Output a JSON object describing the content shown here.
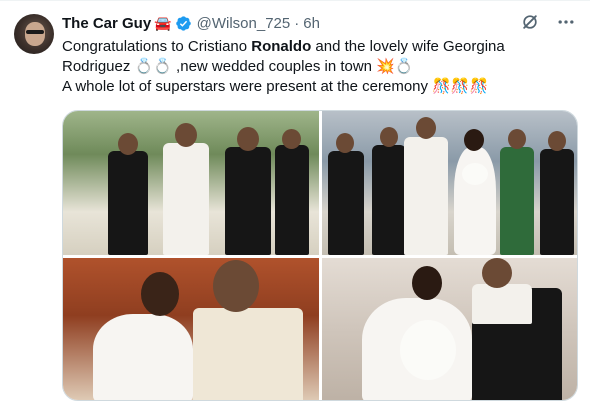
{
  "tweet": {
    "display_name": "The Car Guy",
    "name_emoji": "🚘",
    "handle": "@Wilson_725",
    "separator": "·",
    "timestamp": "6h",
    "text": {
      "line1_pre": "Congratulations to Cristiano ",
      "line1_bold": "Ronaldo",
      "line1_post": " and the lovely wife Georgina",
      "line2": "Rodriguez 💍💍 ,new wedded couples in town 💥💍",
      "line3": "A whole lot of superstars were present at the ceremony 🎊🎊🎊"
    }
  },
  "icons": {
    "verified": "verified-badge-icon",
    "grok": "grok-icon",
    "more": "more-options-icon"
  },
  "colors": {
    "verified_blue": "#1d9bf0",
    "secondary_text": "#536471",
    "primary_text": "#0f1419",
    "border": "#cfd9de"
  },
  "media": {
    "count": 4
  }
}
